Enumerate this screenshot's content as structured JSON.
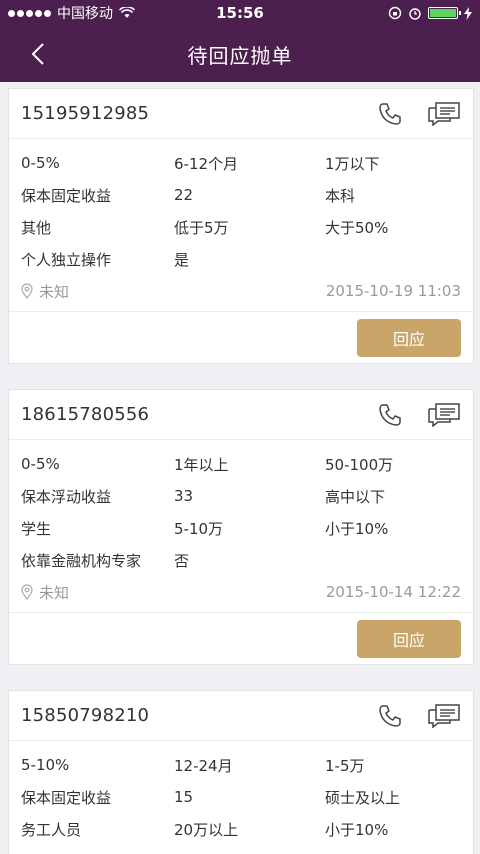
{
  "status_bar": {
    "carrier": "中国移动",
    "time": "15:56"
  },
  "nav": {
    "title": "待回应抛单"
  },
  "cards": [
    {
      "phone": "15195912985",
      "rows": [
        [
          "0-5%",
          "6-12个月",
          "1万以下"
        ],
        [
          "保本固定收益",
          "22",
          "本科"
        ],
        [
          "其他",
          "低于5万",
          "大于50%"
        ],
        [
          "个人独立操作",
          "是",
          ""
        ]
      ],
      "location": "未知",
      "datetime": "2015-10-19 11:03",
      "reply_label": "回应"
    },
    {
      "phone": "18615780556",
      "rows": [
        [
          "0-5%",
          "1年以上",
          "50-100万"
        ],
        [
          "保本浮动收益",
          "33",
          "高中以下"
        ],
        [
          "学生",
          "5-10万",
          "小于10%"
        ],
        [
          "依靠金融机构专家",
          "否",
          ""
        ]
      ],
      "location": "未知",
      "datetime": "2015-10-14 12:22",
      "reply_label": "回应"
    },
    {
      "phone": "15850798210",
      "rows": [
        [
          "5-10%",
          "12-24月",
          "1-5万"
        ],
        [
          "保本固定收益",
          "15",
          "硕士及以上"
        ],
        [
          "务工人员",
          "20万以上",
          "小于10%"
        ]
      ]
    }
  ]
}
